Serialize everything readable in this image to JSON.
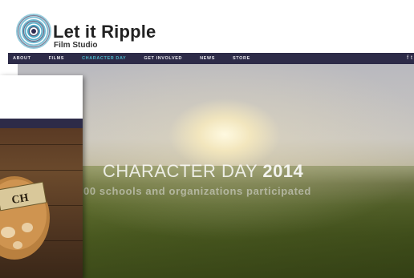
{
  "header": {
    "logo_title": "Let it Ripple",
    "logo_subtitle": "Film Studio"
  },
  "nav": {
    "items": [
      {
        "label": "ABOUT",
        "active": false
      },
      {
        "label": "FILMS",
        "active": false
      },
      {
        "label": "CHARACTER DAY",
        "active": true
      },
      {
        "label": "GET INVOLVED",
        "active": false
      },
      {
        "label": "NEWS",
        "active": false
      },
      {
        "label": "STORE",
        "active": false
      }
    ],
    "social": [
      {
        "icon": "facebook-icon",
        "glyph": "f"
      },
      {
        "icon": "twitter-icon",
        "glyph": "t"
      }
    ]
  },
  "hero": {
    "title_regular": "CHARACTER DAY ",
    "title_bold": "2014",
    "subtitle": "00 schools and organizations participated"
  },
  "overlay": {
    "badge_text": "CH"
  },
  "colors": {
    "nav_bg": "#2d2b48",
    "nav_active": "#4bb4c8",
    "nav_text": "#e8e8ee"
  }
}
